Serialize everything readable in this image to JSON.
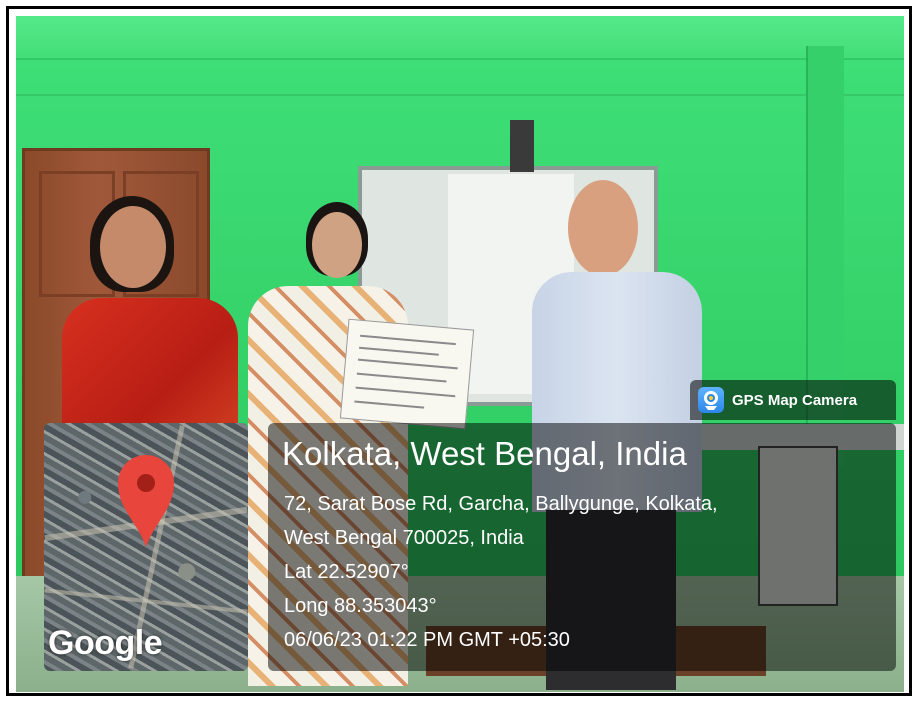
{
  "overlay": {
    "badge_label": "GPS Map Camera",
    "badge_icon": "gps-camera-app-icon",
    "location_title": "Kolkata, West Bengal, India",
    "address_line1": "72, Sarat Bose Rd, Garcha, Ballygunge, Kolkata,",
    "address_line2": "West Bengal 700025, India",
    "latitude": "Lat 22.52907°",
    "longitude": "Long 88.353043°",
    "datetime": "06/06/23 01:22 PM GMT +05:30",
    "map_attribution": "Google",
    "pin_color": "#e8453c"
  },
  "scene": {
    "wall_color": "#39d66e",
    "door_color": "#a0583a"
  }
}
